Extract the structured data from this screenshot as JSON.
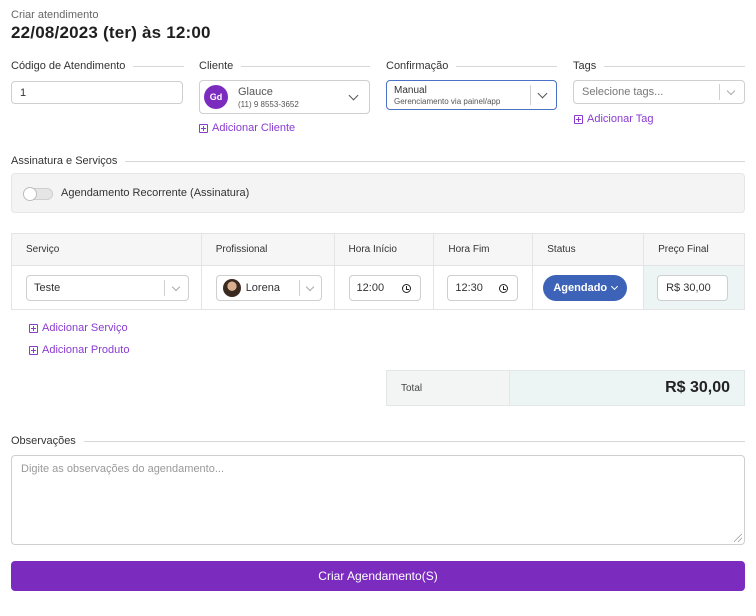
{
  "header": {
    "subtitle": "Criar atendimento",
    "title": "22/08/2023 (ter) às 12:00"
  },
  "fields": {
    "codigo": {
      "label": "Código de Atendimento",
      "value": "1"
    },
    "cliente": {
      "label": "Cliente",
      "avatar_initials": "Gd",
      "name": "Glauce",
      "phone": "(11) 9 8553-3652",
      "add_link": "Adicionar Cliente"
    },
    "confirmacao": {
      "label": "Confirmação",
      "value": "Manual",
      "description": "Gerenciamento via painel/app"
    },
    "tags": {
      "label": "Tags",
      "placeholder": "Selecione tags...",
      "add_link": "Adicionar Tag"
    }
  },
  "assinatura": {
    "section_label": "Assinatura e Serviços",
    "toggle_label": "Agendamento Recorrente (Assinatura)",
    "toggle_on": false
  },
  "services_table": {
    "columns": [
      "Serviço",
      "Profissional",
      "Hora Início",
      "Hora Fim",
      "Status",
      "Preço Final"
    ],
    "rows": [
      {
        "servico": "Teste",
        "profissional": "Lorena",
        "hora_inicio": "12:00",
        "hora_fim": "12:30",
        "status": "Agendado",
        "preco": "R$ 30,00"
      }
    ]
  },
  "actions": {
    "add_service": "Adicionar Serviço",
    "add_product": "Adicionar Produto"
  },
  "total": {
    "label": "Total",
    "value": "R$ 30,00"
  },
  "observacoes": {
    "label": "Observações",
    "placeholder": "Digite as observações do agendamento..."
  },
  "submit_label": "Criar Agendamento(S)",
  "colors": {
    "primary": "#7b2cbf",
    "status_blue": "#3d63b8",
    "link": "#8a3bd1",
    "focus_border": "#4a72c4"
  }
}
